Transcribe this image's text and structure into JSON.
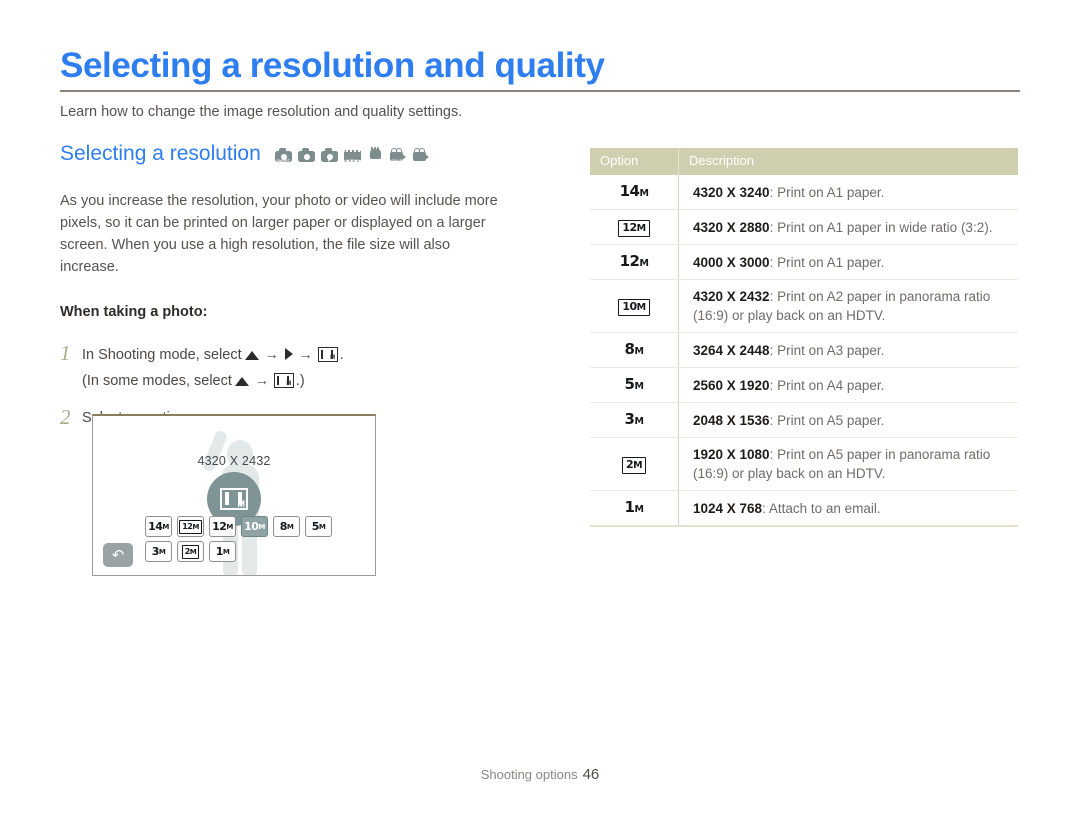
{
  "document": {
    "title": "Selecting a resolution and quality",
    "intro": "Learn how to change the image resolution and quality settings.",
    "footer_label": "Shooting options",
    "footer_page": "46"
  },
  "colors": {
    "title_blue": "#2e7ef0",
    "table_header_khaki": "#cfcfb0",
    "step_number_sage": "#a6ae8e",
    "rule_brown": "#8c8378",
    "icon_slate": "#7d8c8c",
    "selected_option": "#8fa2a4"
  },
  "section": {
    "heading": "Selecting a resolution",
    "mode_icons": [
      {
        "name": "smart-auto-mode-icon",
        "label": "SMART"
      },
      {
        "name": "auto-mode-icon",
        "label": ""
      },
      {
        "name": "program-mode-icon",
        "label": "P"
      },
      {
        "name": "scene-mode-icon",
        "label": "SCENE"
      },
      {
        "name": "dual-is-mode-icon",
        "label": "DUAL"
      },
      {
        "name": "smart-movie-mode-icon",
        "label": "SMART"
      },
      {
        "name": "movie-mode-icon",
        "label": ""
      }
    ],
    "body": "As you increase the resolution, your photo or video will include more pixels, so it can be printed on larger paper or displayed on a larger screen. When you use a high resolution, the file size will also increase.",
    "subhead": "When taking a photo:"
  },
  "steps": [
    {
      "number": "1",
      "line1_a": "In Shooting mode, select",
      "line1_b": ".",
      "line2_a": "(In some modes, select",
      "line2_b": ".)"
    },
    {
      "number": "2",
      "text": "Select an option."
    }
  ],
  "screen": {
    "caption": "4320 X 2432",
    "center_icon": "10M",
    "back_button_glyph": "↶",
    "options_row1": [
      {
        "label": "14",
        "unit": "M",
        "selected": false,
        "framed": false
      },
      {
        "label": "12",
        "unit": "M",
        "selected": false,
        "framed": true
      },
      {
        "label": "12",
        "unit": "M",
        "selected": false,
        "framed": false
      },
      {
        "label": "10",
        "unit": "M",
        "selected": true,
        "framed": false
      },
      {
        "label": "8",
        "unit": "M",
        "selected": false,
        "framed": false
      },
      {
        "label": "5",
        "unit": "M",
        "selected": false,
        "framed": false
      }
    ],
    "options_row2": [
      {
        "label": "3",
        "unit": "M",
        "selected": false,
        "framed": false
      },
      {
        "label": "2",
        "unit": "M",
        "selected": false,
        "framed": true
      },
      {
        "label": "1",
        "unit": "M",
        "selected": false,
        "framed": false
      }
    ]
  },
  "table": {
    "headers": {
      "option": "Option",
      "description": "Description"
    },
    "rows": [
      {
        "icon_label": "14",
        "icon_unit": "M",
        "framed": false,
        "resolution": "4320 X 3240",
        "description": ": Print on A1 paper."
      },
      {
        "icon_label": "12",
        "icon_unit": "M",
        "framed": true,
        "resolution": "4320 X 2880",
        "description": ": Print on A1 paper in wide ratio (3:2)."
      },
      {
        "icon_label": "12",
        "icon_unit": "M",
        "framed": false,
        "resolution": "4000 X 3000",
        "description": ": Print on A1 paper."
      },
      {
        "icon_label": "10",
        "icon_unit": "M",
        "framed": true,
        "resolution": "4320 X 2432",
        "description": ": Print on A2 paper in panorama ratio (16:9) or play back on an HDTV."
      },
      {
        "icon_label": "8",
        "icon_unit": "M",
        "framed": false,
        "resolution": "3264 X 2448",
        "description": ": Print on A3 paper."
      },
      {
        "icon_label": "5",
        "icon_unit": "M",
        "framed": false,
        "resolution": "2560 X 1920",
        "description": ": Print on A4 paper."
      },
      {
        "icon_label": "3",
        "icon_unit": "M",
        "framed": false,
        "resolution": "2048 X 1536",
        "description": ": Print on A5 paper."
      },
      {
        "icon_label": "2",
        "icon_unit": "M",
        "framed": true,
        "resolution": "1920 X 1080",
        "description": ": Print on A5 paper in panorama ratio (16:9) or play back on an HDTV."
      },
      {
        "icon_label": "1",
        "icon_unit": "M",
        "framed": false,
        "resolution": "1024 X 768",
        "description": ": Attach to an email."
      }
    ]
  }
}
